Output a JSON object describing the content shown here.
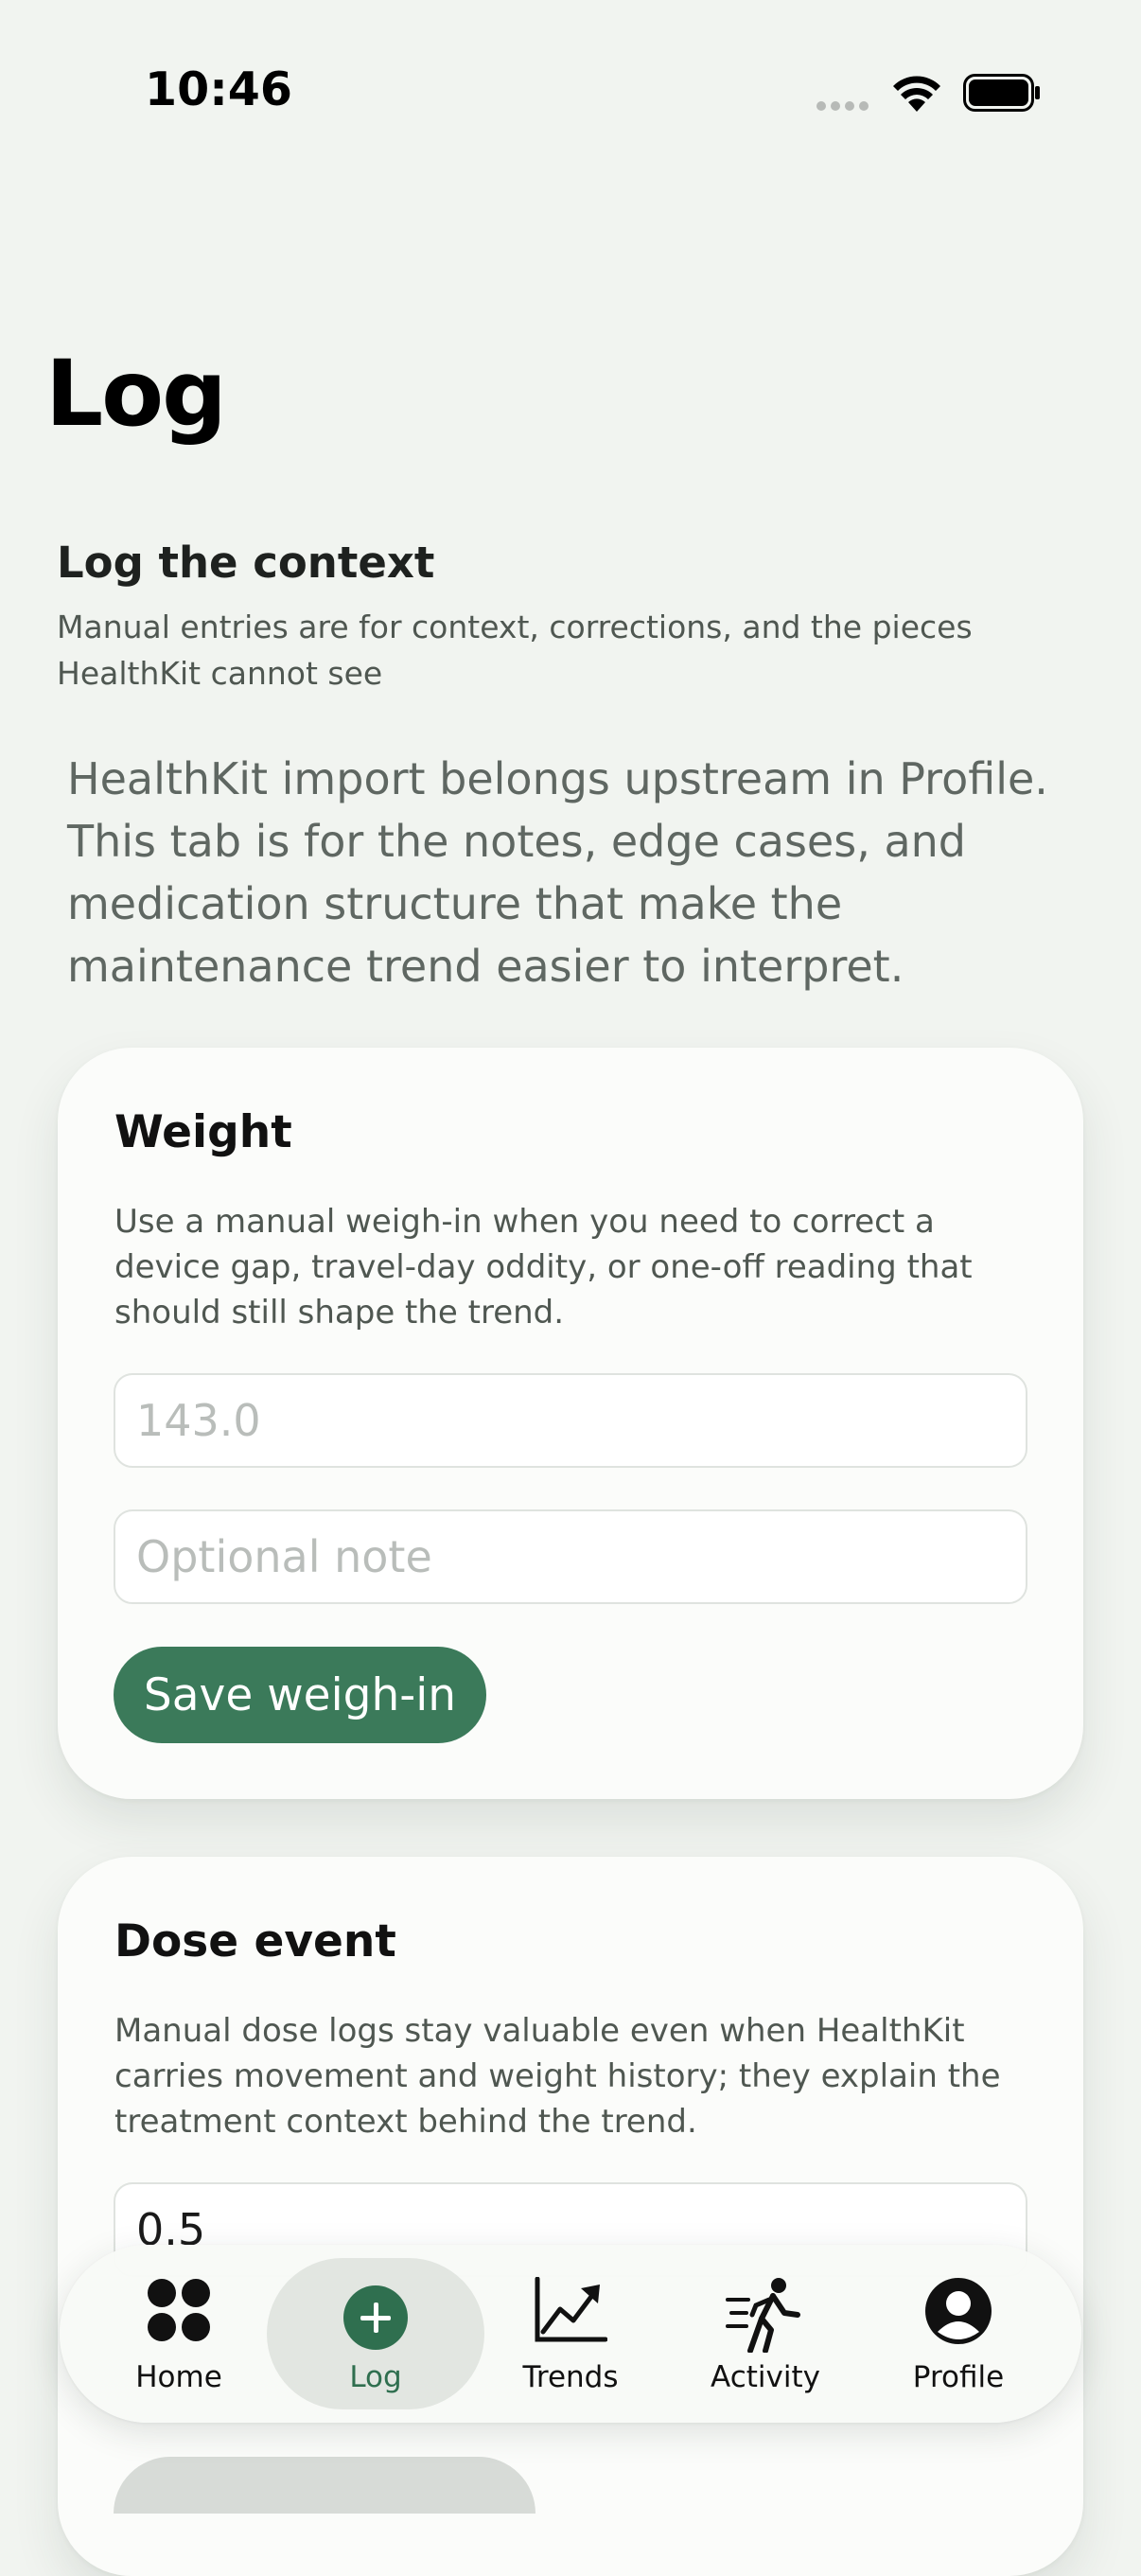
{
  "status_bar": {
    "time": "10:46"
  },
  "page": {
    "title": "Log",
    "section_title": "Log the context",
    "section_subtitle": "Manual entries are for context, corrections, and the pieces HealthKit cannot see",
    "intro": "HealthKit import belongs upstream in Profile. This tab is for the notes, edge cases, and medication structure that make the maintenance trend easier to interpret."
  },
  "weight_card": {
    "title": "Weight",
    "description": "Use a manual weigh-in when you need to correct a device gap, travel-day oddity, or one-off reading that should still shape the trend.",
    "weight_placeholder": "143.0",
    "note_placeholder": "Optional note",
    "save_label": "Save weigh-in"
  },
  "dose_card": {
    "title": "Dose event",
    "description": "Manual dose logs stay valuable even when HealthKit carries movement and weight history; they explain the treatment context behind the trend.",
    "dose_value": "0.5"
  },
  "tabbar": {
    "tabs": [
      {
        "label": "Home",
        "icon": "grid-icon"
      },
      {
        "label": "Log",
        "icon": "plus-circle-icon",
        "active": true
      },
      {
        "label": "Trends",
        "icon": "chart-trend-icon"
      },
      {
        "label": "Activity",
        "icon": "walking-figure-icon"
      },
      {
        "label": "Profile",
        "icon": "person-circle-icon"
      }
    ]
  },
  "colors": {
    "accent": "#3b7a5a",
    "background": "#f1f4f0",
    "card": "#fbfcfa"
  }
}
